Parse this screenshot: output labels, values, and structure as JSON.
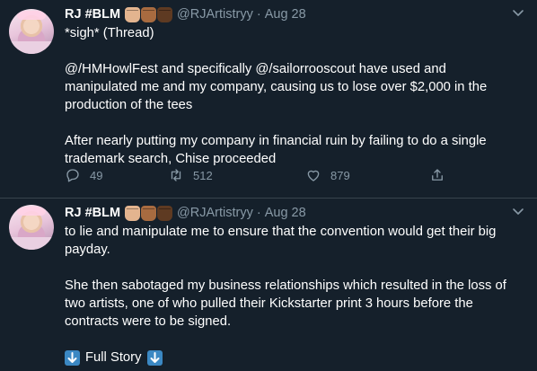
{
  "tweets": [
    {
      "name": "RJ #BLM",
      "handle": "@RJArtistryy",
      "separator": "·",
      "date": "Aug 28",
      "paragraphs": [
        "*sigh* (Thread)",
        "",
        "@/HMHowlFest and specifically @/sailorrooscout have used and manipulated me and my company, causing us to lose over $2,000 in the production of the tees",
        "",
        "After nearly putting my company in financial ruin by failing to do a single trademark search, Chise proceeded"
      ],
      "reply_count": "49",
      "retweet_count": "512",
      "like_count": "879"
    },
    {
      "name": "RJ #BLM",
      "handle": "@RJArtistryy",
      "separator": "·",
      "date": "Aug 28",
      "paragraphs": [
        "to lie and manipulate me to ensure that the convention would get their big payday.",
        "",
        "She then sabotaged my business relationships which resulted in the loss of two artists, one of who pulled their Kickstarter print 3 hours before the contracts were to be signed.",
        ""
      ],
      "story_label": "Full Story"
    }
  ],
  "icons": {
    "reply": "reply-icon",
    "retweet": "retweet-icon",
    "like": "heart-icon",
    "share": "share-icon",
    "menu": "chevron-down-icon",
    "arrow": "down-arrow-emoji-icon",
    "fists": [
      "raised-fist-light-icon",
      "raised-fist-medium-icon",
      "raised-fist-dark-icon"
    ]
  },
  "colors": {
    "background": "#15202b",
    "secondary_text": "#8899a6",
    "divider": "#38444d",
    "arrow_emoji": "#3b88c3"
  }
}
